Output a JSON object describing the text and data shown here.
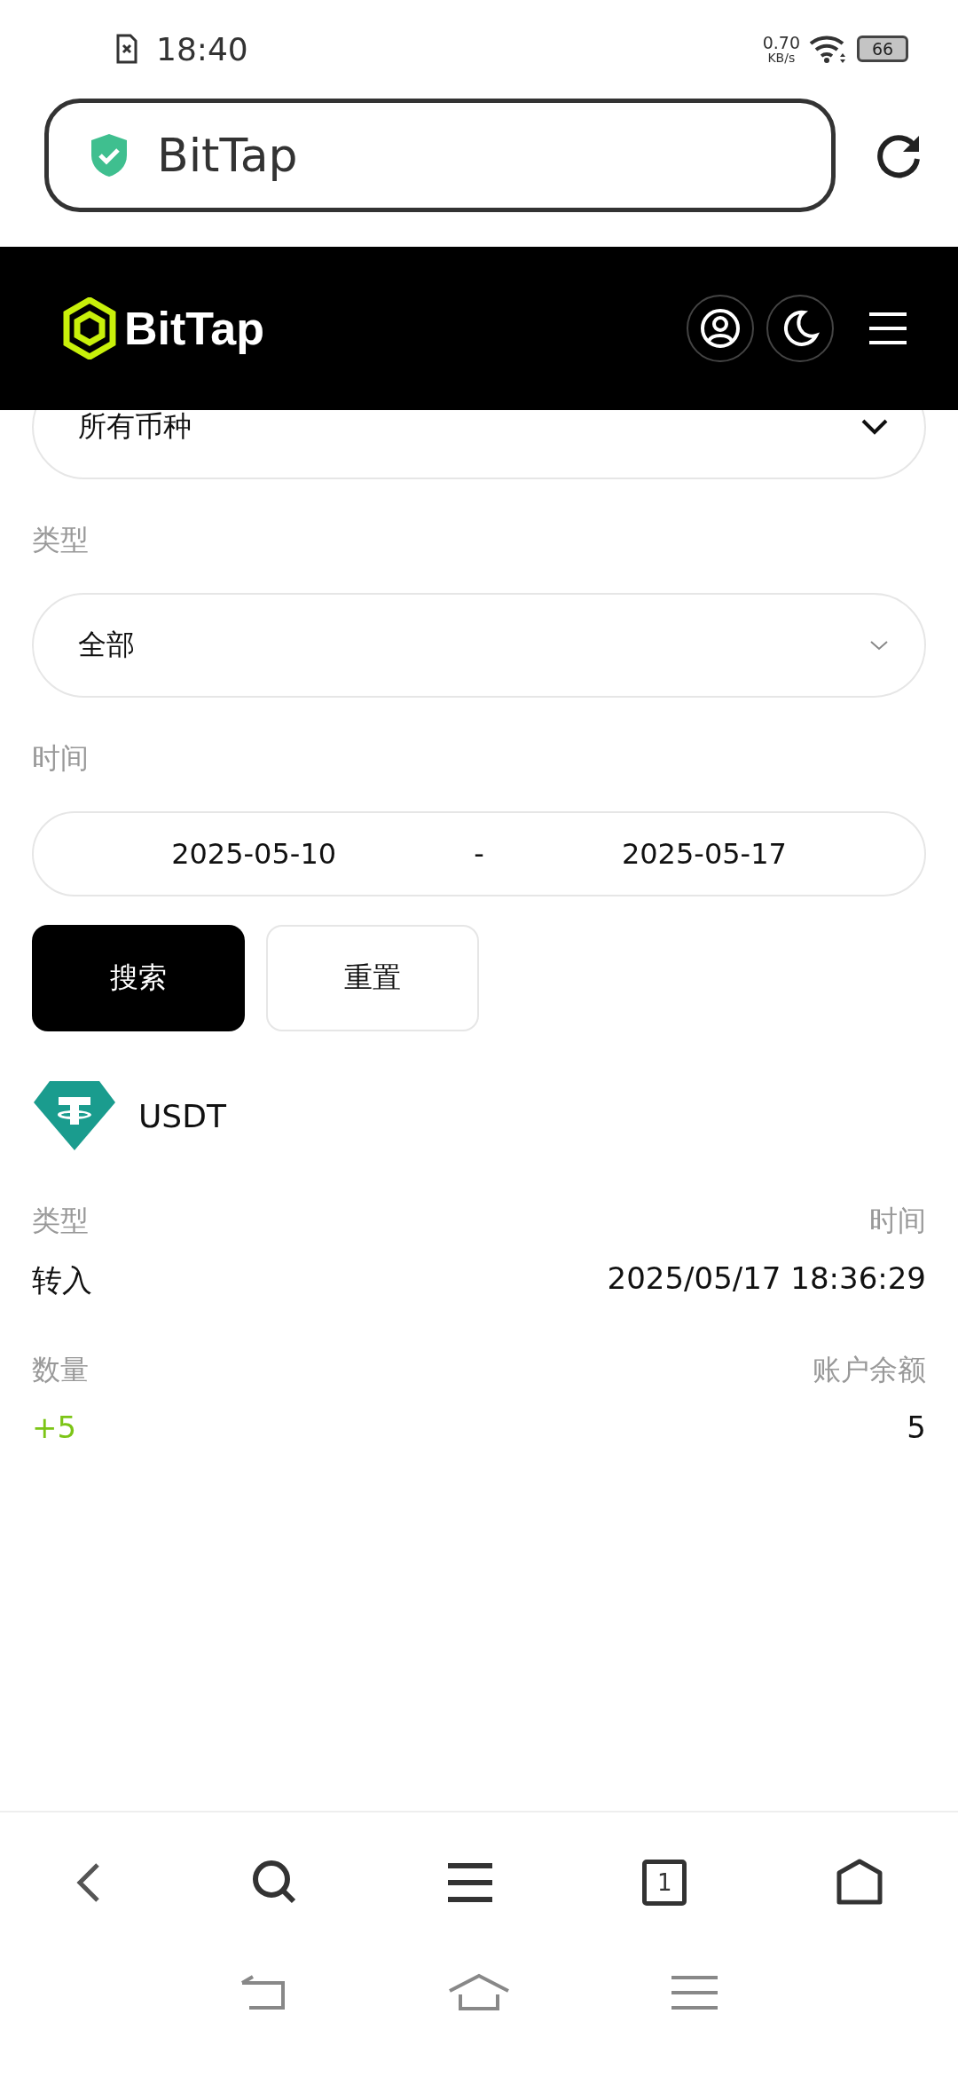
{
  "status_bar": {
    "time": "18:40",
    "net_speed_value": "0.70",
    "net_speed_unit": "KB/s",
    "battery": "66"
  },
  "browser": {
    "url_title": "BitTap"
  },
  "header": {
    "logo_text": "BitTap"
  },
  "filters": {
    "currency_select": {
      "value": "所有币种"
    },
    "type_label": "类型",
    "type_select": {
      "value": "全部"
    },
    "time_label": "时间",
    "date_from": "2025-05-10",
    "date_separator": "-",
    "date_to": "2025-05-17",
    "buttons": [
      {
        "label": "搜索",
        "kind": "primary"
      },
      {
        "label": "重置",
        "kind": "secondary"
      }
    ]
  },
  "record": {
    "currency": "USDT",
    "fields": [
      {
        "label": "类型",
        "value": "转入",
        "positive": false
      },
      {
        "label": "时间",
        "value": "2025/05/17 18:36:29",
        "positive": false
      },
      {
        "label": "数量",
        "value": "+5",
        "positive": true
      },
      {
        "label": "账户余额",
        "value": "5",
        "positive": false
      }
    ]
  },
  "browser_toolbar": {
    "tab_count": "1"
  }
}
